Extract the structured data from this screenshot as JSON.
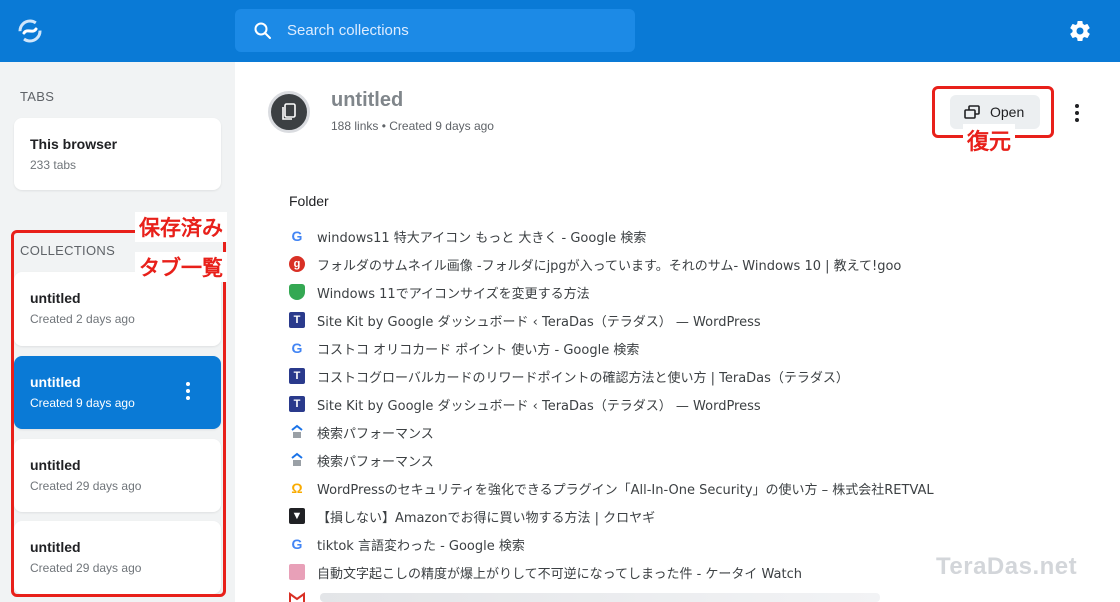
{
  "header": {
    "search_placeholder": "Search collections"
  },
  "sidebar": {
    "tabs_label": "TABS",
    "browser_card": {
      "title": "This browser",
      "subtitle": "233 tabs"
    },
    "collections_label": "COLLECTIONS",
    "collections": [
      {
        "title": "untitled",
        "subtitle": "Created 2 days ago"
      },
      {
        "title": "untitled",
        "subtitle": "Created 9 days ago",
        "active": true
      },
      {
        "title": "untitled",
        "subtitle": "Created 29 days ago"
      },
      {
        "title": "untitled",
        "subtitle": "Created 29 days ago"
      }
    ]
  },
  "main": {
    "title": "untitled",
    "meta": "188 links  •  Created 9 days ago",
    "open_label": "Open",
    "folder_label": "Folder",
    "links": [
      {
        "icon": "google-favicon",
        "text": "windows11 特大アイコン もっと 大きく - Google 検索"
      },
      {
        "icon": "red-circle-favicon",
        "text": "フォルダのサムネイル画像 -フォルダにjpgが入っています。それのサム- Windows 10 | 教えて!goo"
      },
      {
        "icon": "green-shield-favicon",
        "text": "Windows 11でアイコンサイズを変更する方法"
      },
      {
        "icon": "teradas-favicon",
        "text": "Site Kit by Google ダッシュボード ‹ TeraDas（テラダス） — WordPress"
      },
      {
        "icon": "google-favicon",
        "text": "コストコ オリコカード ポイント 使い方 - Google 検索"
      },
      {
        "icon": "teradas-favicon",
        "text": "コストコグローバルカードのリワードポイントの確認方法と使い方 | TeraDas（テラダス）"
      },
      {
        "icon": "teradas-favicon",
        "text": "Site Kit by Google ダッシュボード ‹ TeraDas（テラダス） — WordPress"
      },
      {
        "icon": "search-console-favicon",
        "text": "検索パフォーマンス"
      },
      {
        "icon": "search-console-favicon",
        "text": "検索パフォーマンス"
      },
      {
        "icon": "aio-security-favicon",
        "text": "WordPressのセキュリティを強化できるプラグイン「All-In-One Security」の使い方 – 株式会社RETVAL"
      },
      {
        "icon": "kuroyagi-favicon",
        "text": "【損しない】Amazonでお得に買い物する方法 | クロヤギ"
      },
      {
        "icon": "google-favicon",
        "text": "tiktok 言語変わった - Google 検索"
      },
      {
        "icon": "ktai-watch-favicon",
        "text": "自動文字起こしの精度が爆上がりして不可逆になってしまった件 - ケータイ Watch"
      }
    ]
  },
  "annotations": {
    "collections_note_line1": "保存済み",
    "collections_note_line2": "タブ一覧",
    "open_note": "復元"
  },
  "watermark": "TeraDas.net",
  "colors": {
    "header_blue": "#0a7ad6",
    "annotation_red": "#e8201a"
  }
}
